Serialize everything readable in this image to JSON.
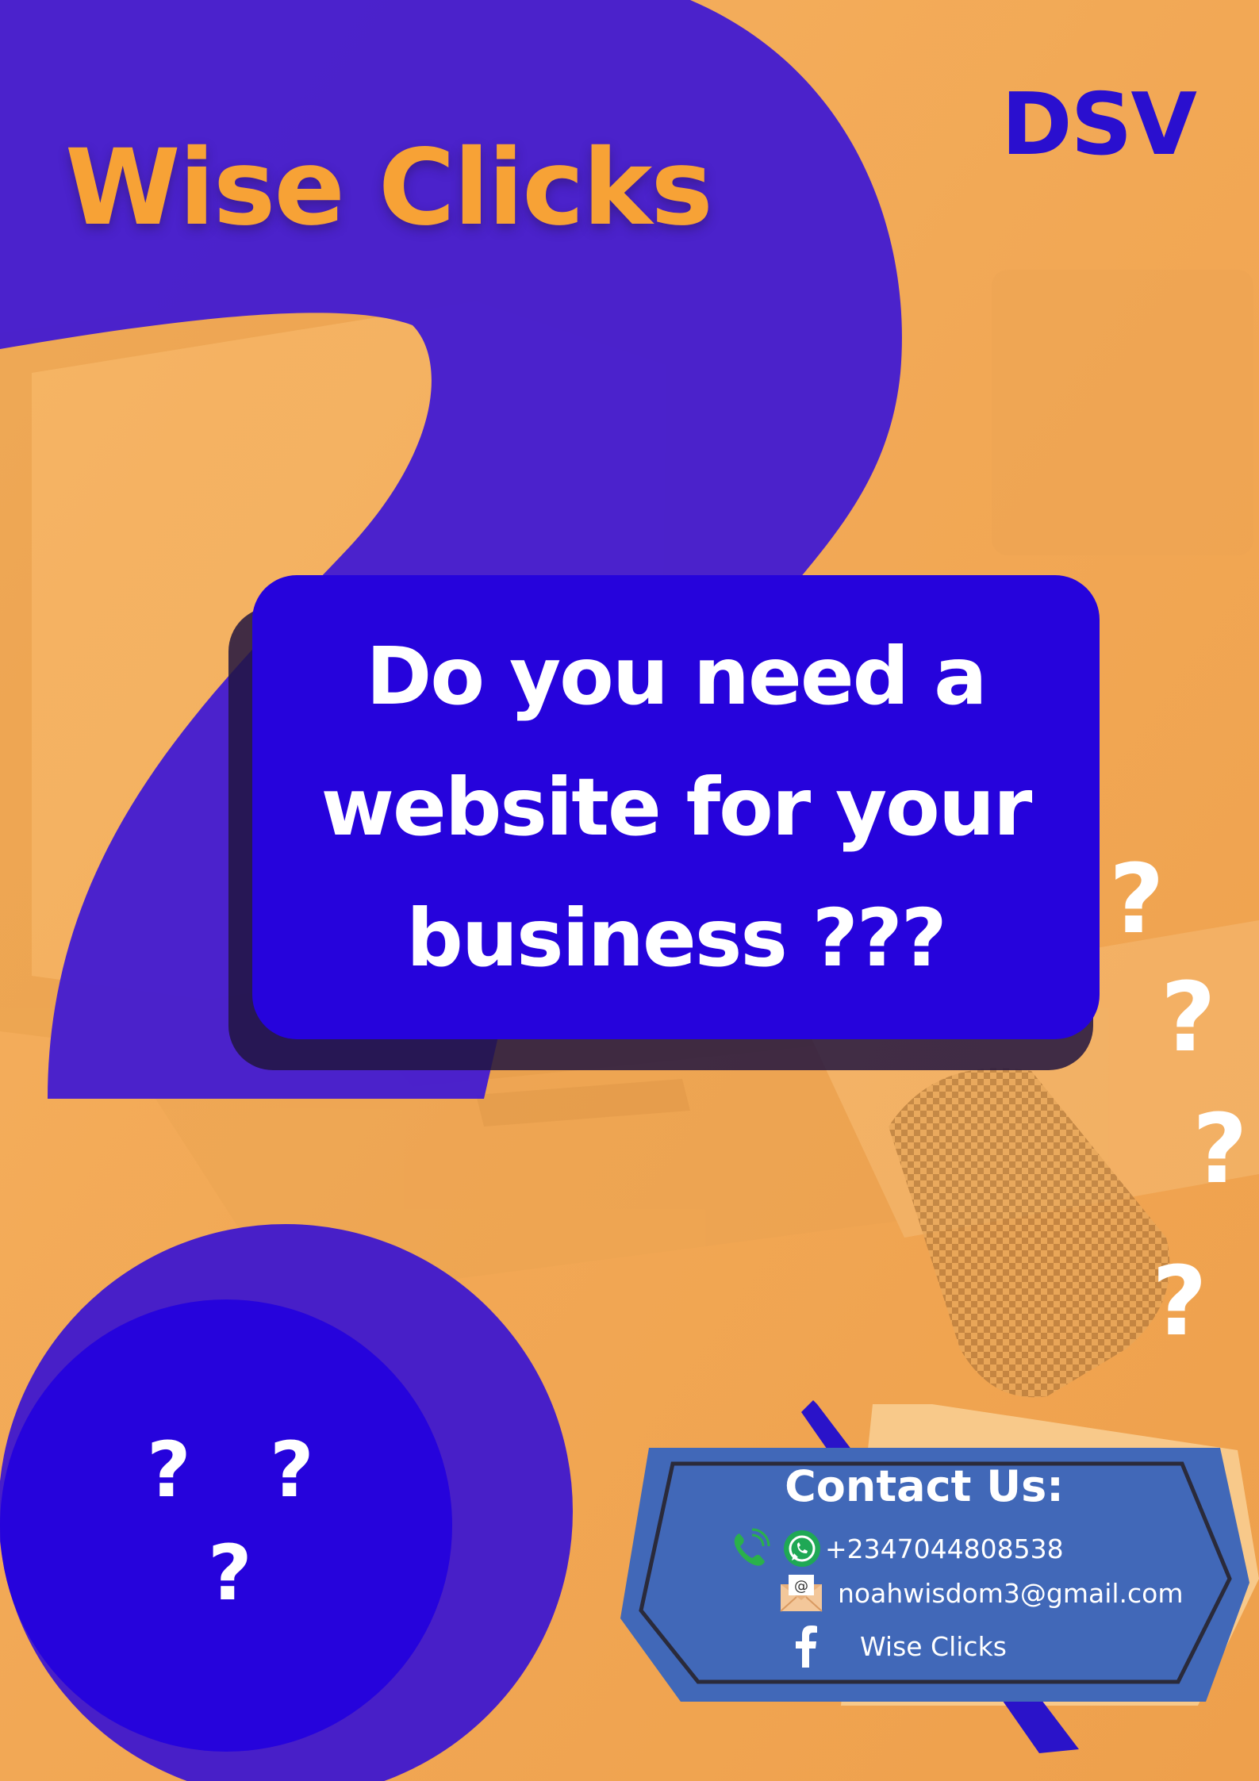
{
  "poster": {
    "brand": "Wise Clicks",
    "logo": "DSV",
    "headline": "Do you need a website for your business ???",
    "question_mark": "?",
    "colors": {
      "background": "#f2a853",
      "purple_shape": "#441cd0",
      "blue_box": "#2603dc",
      "brand_orange": "#f7a236",
      "contact_panel": "#4168b8"
    },
    "contact": {
      "title": "Contact Us:",
      "phone": "+2347044808538",
      "email": "noahwisdom3@gmail.com",
      "facebook": "Wise Clicks",
      "icons": [
        "phone-icon",
        "whatsapp-icon",
        "email-envelope-icon",
        "facebook-icon"
      ]
    }
  }
}
